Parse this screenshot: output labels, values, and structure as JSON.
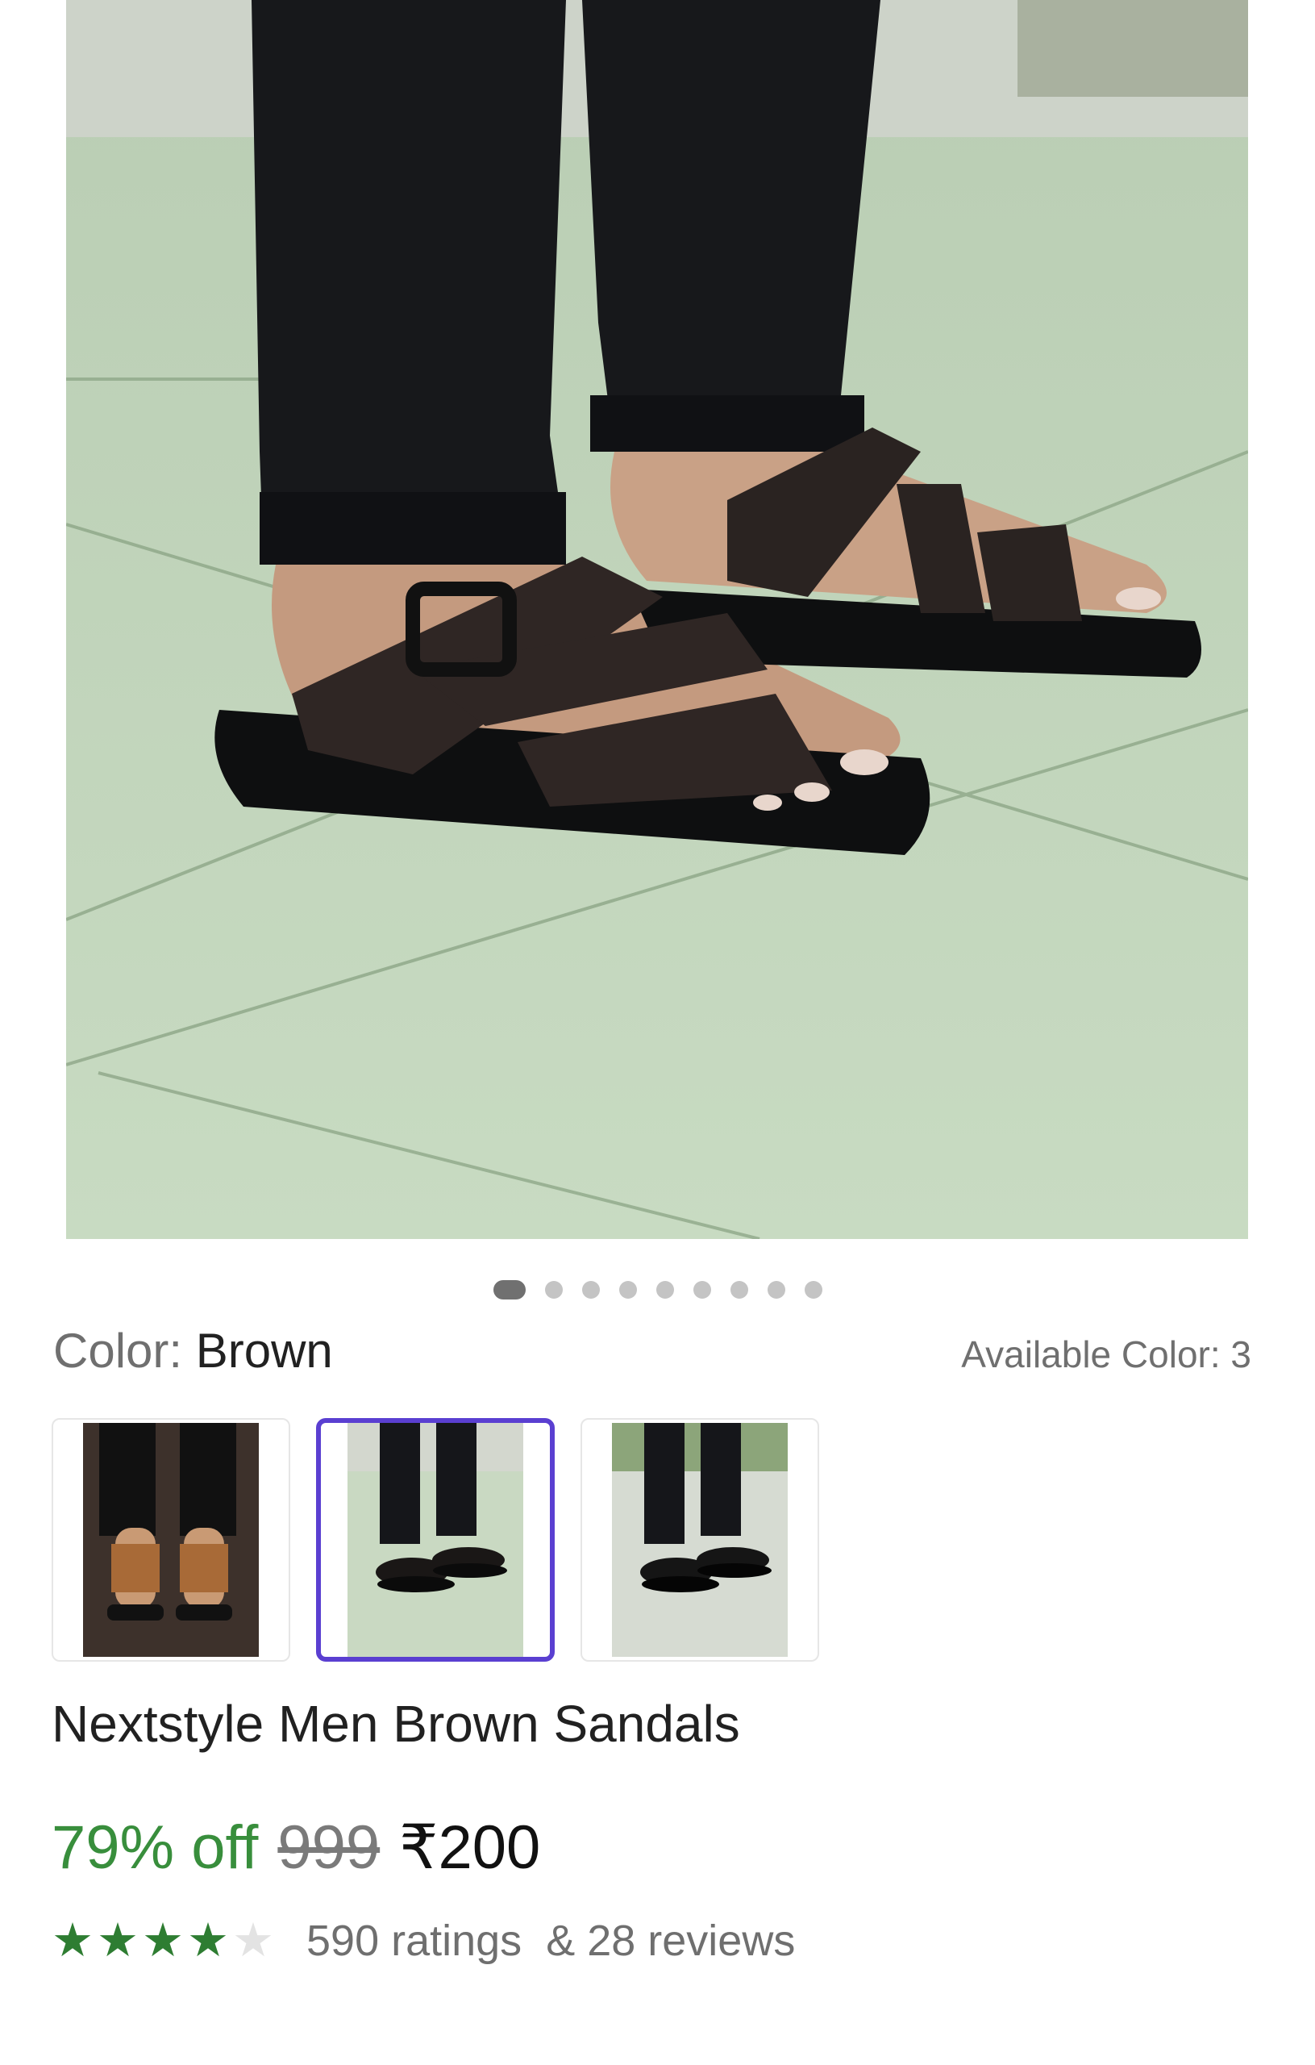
{
  "product": {
    "color_label": "Color:",
    "color_value": "Brown",
    "available_colors": "Available Color: 3",
    "title": "Nextstyle Men Brown Sandals",
    "discount": "79% off",
    "mrp": "999",
    "price": "₹200",
    "rating": 4,
    "rating_max": 5,
    "ratings_text": "590 ratings",
    "reviews_text": "& 28 reviews"
  },
  "gallery": {
    "image_count": 9,
    "active_index": 0
  },
  "swatches": [
    {
      "name": "tan",
      "selected": false
    },
    {
      "name": "brown",
      "selected": true
    },
    {
      "name": "black",
      "selected": false
    }
  ],
  "colors": {
    "accent": "#5a3fd1",
    "discount": "#388e3c",
    "star": "#2e7d32",
    "floor": "#c6d8bf"
  }
}
